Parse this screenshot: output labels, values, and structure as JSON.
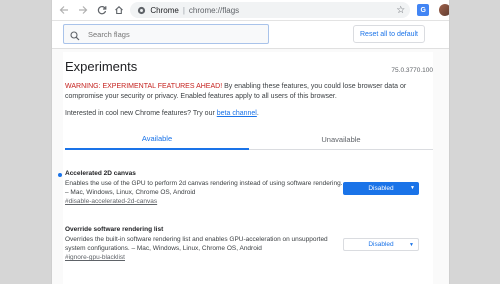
{
  "toolbar": {
    "app_label": "Chrome",
    "separator": "|",
    "url": "chrome://flags"
  },
  "search": {
    "placeholder": "Search flags"
  },
  "reset_button": "Reset all to default",
  "header": {
    "title": "Experiments",
    "version": "75.0.3770.100"
  },
  "warning": {
    "lead": "WARNING: EXPERIMENTAL FEATURES AHEAD!",
    "body": " By enabling these features, you could lose browser data or compromise your security or privacy. Enabled features apply to all users of this browser."
  },
  "interest": {
    "text": "Interested in cool new Chrome features? Try our ",
    "link": "beta channel",
    "end": "."
  },
  "tabs": [
    {
      "label": "Available"
    },
    {
      "label": "Unavailable"
    }
  ],
  "experiments": [
    {
      "name": "Accelerated 2D canvas",
      "description": "Enables the use of the GPU to perform 2d canvas rendering instead of using software rendering. – Mac, Windows, Linux, Chrome OS, Android",
      "link": "#disable-accelerated-2d-canvas",
      "value": "Disabled"
    },
    {
      "name": "Override software rendering list",
      "description": "Overrides the built-in software rendering list and enables GPU-acceleration on unsupported system configurations. – Mac, Windows, Linux, Chrome OS, Android",
      "link": "#ignore-gpu-blacklist",
      "value": "Disabled"
    }
  ],
  "colors": {
    "accent": "#1a73e8",
    "warning": "#c5221f"
  }
}
